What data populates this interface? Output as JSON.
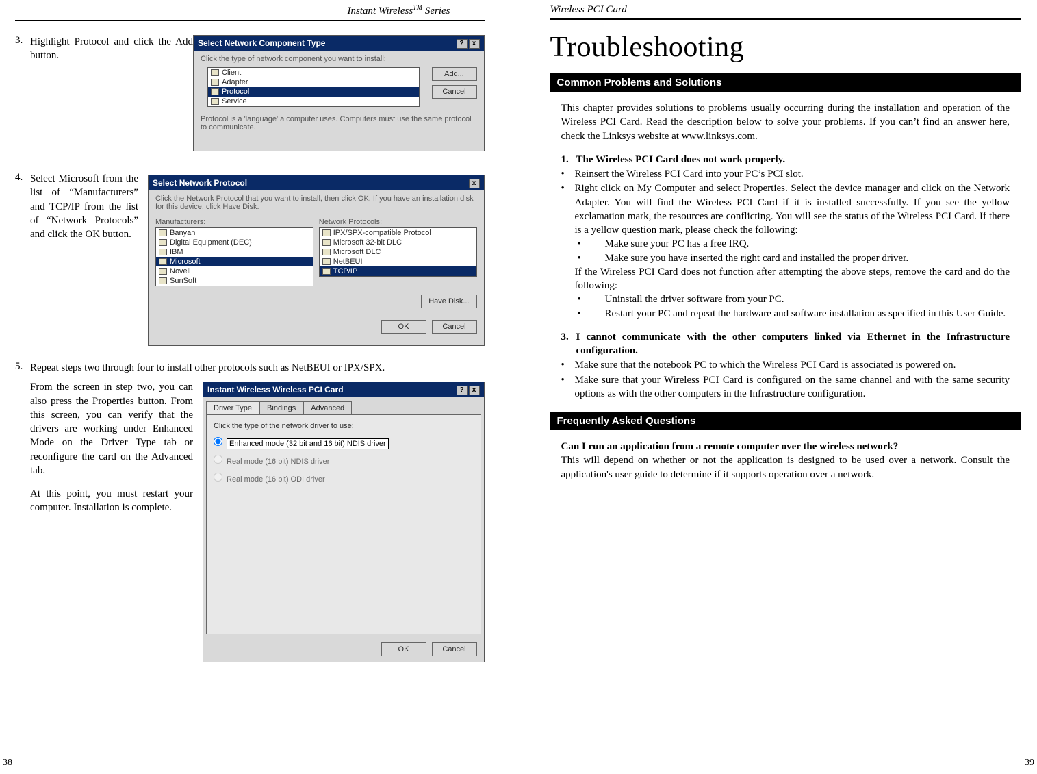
{
  "left": {
    "header_prefix": "Instant Wireless",
    "header_tm": "TM",
    "header_suffix": " Series",
    "page_no": "38",
    "step3": {
      "n": "3.",
      "text": "Highlight Protocol and click the Add button."
    },
    "step4": {
      "n": "4.",
      "text": "Select Microsoft from the list of “Manufacturers” and TCP/IP from the list of “Network Protocols” and click the OK button."
    },
    "step5_top": {
      "n": "5.",
      "text": "Repeat steps two through four to install other protocols such as NetBEUI or IPX/SPX."
    },
    "step5_p1": "From the screen in step two, you can also press the Properties button. From this screen, you can verify that the drivers are working under Enhanced Mode on the Driver Type tab or reconfigure the card on the Advanced tab.",
    "step5_p2": "At this point, you must restart your computer. Installation is complete.",
    "fig1": {
      "title": "Select Network Component Type",
      "instr": "Click the type of network component you want to install:",
      "items": [
        "Client",
        "Adapter",
        "Protocol",
        "Service"
      ],
      "selected": 2,
      "desc": "Protocol is a 'language' a computer uses. Computers must use the same protocol to communicate.",
      "btn_add": "Add...",
      "btn_cancel": "Cancel"
    },
    "fig2": {
      "title": "Select Network Protocol",
      "instr": "Click the Network Protocol that you want to install, then click OK. If you have an installation disk for this device, click Have Disk.",
      "mlabel": "Manufacturers:",
      "plabel": "Network Protocols:",
      "m": [
        "Banyan",
        "Digital Equipment (DEC)",
        "IBM",
        "Microsoft",
        "Novell",
        "SunSoft"
      ],
      "m_sel": 3,
      "p": [
        "IPX/SPX-compatible Protocol",
        "Microsoft 32-bit DLC",
        "Microsoft DLC",
        "NetBEUI",
        "TCP/IP"
      ],
      "p_sel": 4,
      "btn_disk": "Have Disk...",
      "btn_ok": "OK",
      "btn_cancel": "Cancel"
    },
    "fig3": {
      "title": "Instant Wireless Wireless PCI Card",
      "tabs": [
        "Driver Type",
        "Bindings",
        "Advanced"
      ],
      "instr": "Click the type of the network driver to use:",
      "r1": "Enhanced mode (32 bit and 16 bit) NDIS driver",
      "r2": "Real mode (16 bit) NDIS driver",
      "r3": "Real mode (16 bit) ODI driver",
      "btn_ok": "OK",
      "btn_cancel": "Cancel"
    }
  },
  "right": {
    "header": "Wireless PCI Card",
    "page_no": "39",
    "title": "Troubleshooting",
    "bar1": "Common Problems and Solutions",
    "intro": "This chapter provides solutions to problems usually occurring during the installation and operation of the Wireless PCI Card. Read the description below to solve your problems. If you can’t find an answer here, check the Linksys website at www.linksys.com.",
    "p1": {
      "n": "1.",
      "t": "The Wireless PCI Card does not work properly."
    },
    "b1": "Reinsert the Wireless PCI Card into your PC’s PCI slot.",
    "b2": "Right click on My Computer and select Properties. Select the device manager and click on the Network Adapter. You will find the Wireless PCI Card if it is installed successfully. If you see the yellow exclamation mark, the resources are conflicting. You will see the status of the Wireless PCI Card. If there is a yellow question mark, please check the following:",
    "s1": "Make sure your PC has a free IRQ.",
    "s2": "Make sure you have inserted the right card and installed the proper driver.",
    "mid": "If the Wireless PCI Card does not function after attempting the above steps, remove the card and do the following:",
    "s3": "Uninstall the driver software from your PC.",
    "s4": "Restart your PC and repeat the hardware and software installation as specified in this User Guide.",
    "p3": {
      "n": "3.",
      "t": "I cannot communicate with the other computers linked via Ethernet in the Infrastructure configuration."
    },
    "b3": "Make sure that the notebook PC to which the Wireless PCI Card is associated is powered on.",
    "b4": "Make sure that your Wireless PCI Card is configured on the same channel and with the same security options as with the other computers in the Infrastructure configuration.",
    "bar2": "Frequently Asked Questions",
    "faq_q": "Can I run an application from a remote computer over the wireless network?",
    "faq_a": "This will depend on whether or not the application is designed to be used over a network. Consult the application's user guide to determine if it supports operation over a network."
  }
}
